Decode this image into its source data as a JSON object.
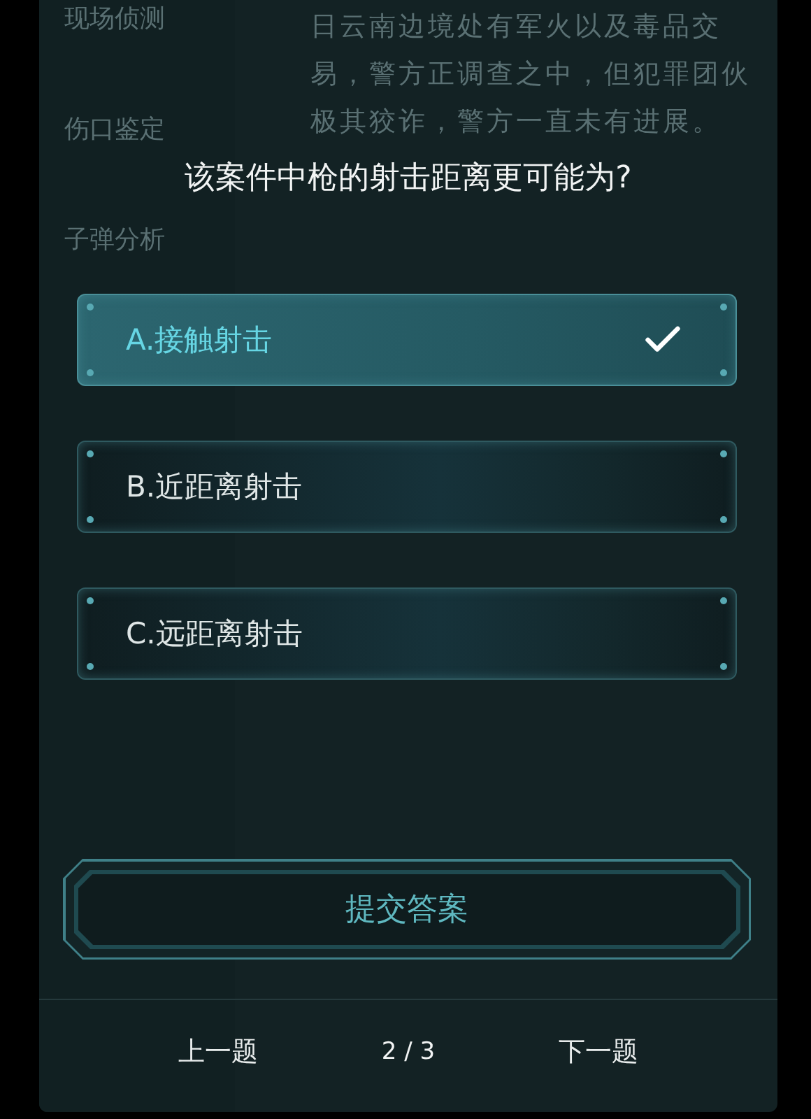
{
  "background": {
    "sidebar_items": [
      "现场侦测",
      "伤口鉴定",
      "子弹分析"
    ],
    "case_text": "日云南边境处有军火以及毒品交易，警方正调查之中，但犯罪团伙极其狡诈，警方一直未有进展。"
  },
  "question": "该案件中枪的射击距离更可能为?",
  "options": [
    {
      "label": "A.接触射击",
      "selected": true
    },
    {
      "label": "B.近距离射击",
      "selected": false
    },
    {
      "label": "C.远距离射击",
      "selected": false
    }
  ],
  "submit_button": "提交答案",
  "footer": {
    "previous": "上一题",
    "page": "2 / 3",
    "next": "下一题"
  }
}
